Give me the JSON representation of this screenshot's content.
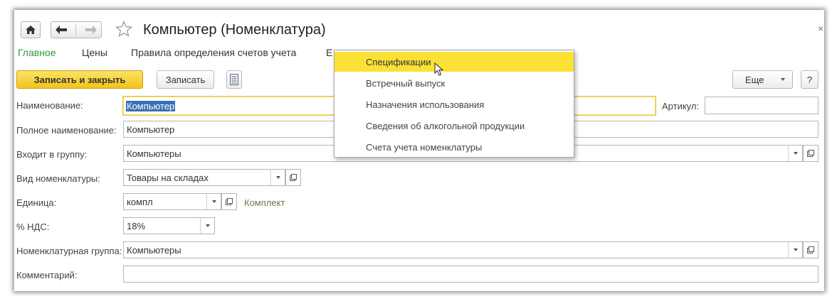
{
  "header": {
    "title": "Компьютер (Номенклатура)",
    "close_glyph": "×",
    "icons": [
      "home-icon",
      "back-arrow-icon",
      "forward-arrow-icon",
      "favorite-star-icon"
    ]
  },
  "tabs": [
    {
      "label": "Главное",
      "active": true
    },
    {
      "label": "Цены",
      "active": false
    },
    {
      "label": "Правила определения счетов учета",
      "active": false
    },
    {
      "label": "Е",
      "active": false
    }
  ],
  "toolbar": {
    "save_close_label": "Записать и закрыть",
    "save_label": "Записать",
    "more_label": "Еще",
    "help_label": "?"
  },
  "form": {
    "name_label": "Наименование:",
    "name_value": "Компьютер",
    "article_label": "Артикул:",
    "article_value": "",
    "full_name_label": "Полное наименование:",
    "full_name_value": "Компьютер",
    "group_label": "Входит в группу:",
    "group_value": "Компьютеры",
    "type_label": "Вид номенклатуры:",
    "type_value": "Товары на складах",
    "unit_label": "Единица:",
    "unit_value": "компл",
    "unit_comment": "Комплект",
    "vat_label": "% НДС:",
    "vat_value": "18%",
    "nom_group_label": "Номенклатурная группа:",
    "nom_group_value": "Компьютеры",
    "comment_label": "Комментарий:",
    "comment_value": ""
  },
  "popup": {
    "items": [
      {
        "label": "Спецификации",
        "hover": true
      },
      {
        "label": "Встречный выпуск",
        "hover": false
      },
      {
        "label": "Назначения использования",
        "hover": false
      },
      {
        "label": "Сведения об алкогольной продукции",
        "hover": false
      },
      {
        "label": "Счета учета номенклатуры",
        "hover": false
      }
    ]
  },
  "colors": {
    "primary_button": "#f2c318",
    "active_tab": "#2e9a3a",
    "popup_hover": "#fbe036",
    "selection": "#3b6fb6"
  }
}
